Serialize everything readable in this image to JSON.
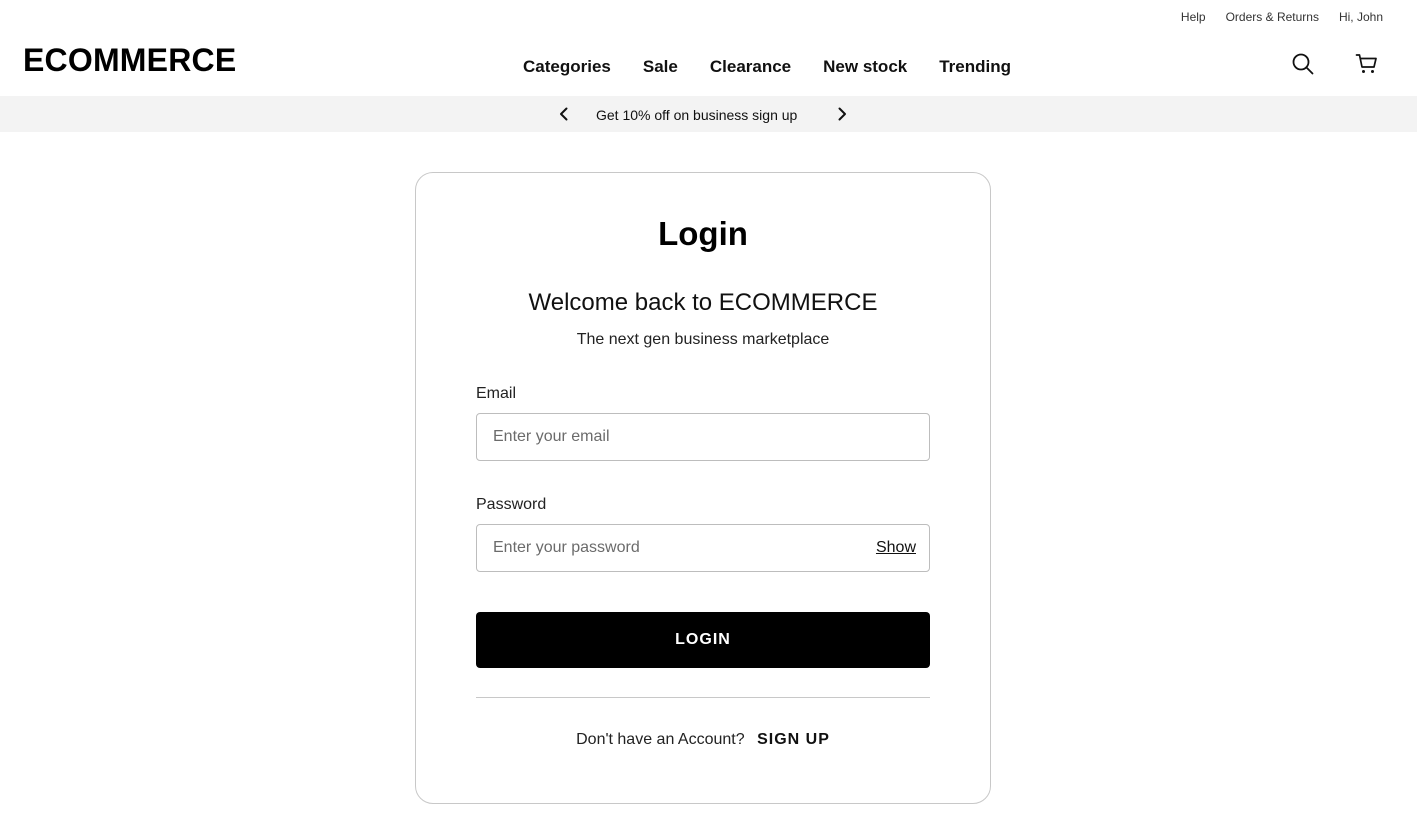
{
  "utility_nav": {
    "help": "Help",
    "orders_returns": "Orders & Returns",
    "greeting": "Hi, John"
  },
  "header": {
    "logo": "ECOMMERCE",
    "nav": [
      "Categories",
      "Sale",
      "Clearance",
      "New stock",
      "Trending"
    ],
    "icons": [
      "search-icon",
      "cart-icon"
    ]
  },
  "promo": {
    "text": "Get 10% off on business sign up",
    "icons": [
      "chevron-left-icon",
      "chevron-right-icon"
    ]
  },
  "login": {
    "title": "Login",
    "welcome": "Welcome back to ECOMMERCE",
    "tagline": "The next gen business marketplace",
    "email_label": "Email",
    "email_placeholder": "Enter your email",
    "password_label": "Password",
    "password_placeholder": "Enter your password",
    "show_label": "Show",
    "submit_label": "LOGIN",
    "no_account_text": "Don't have an Account?",
    "signup_label": "SIGN UP"
  },
  "colors": {
    "primary": "#000000",
    "promo_background": "#f3f3f3",
    "border": "#c8c8c8"
  }
}
